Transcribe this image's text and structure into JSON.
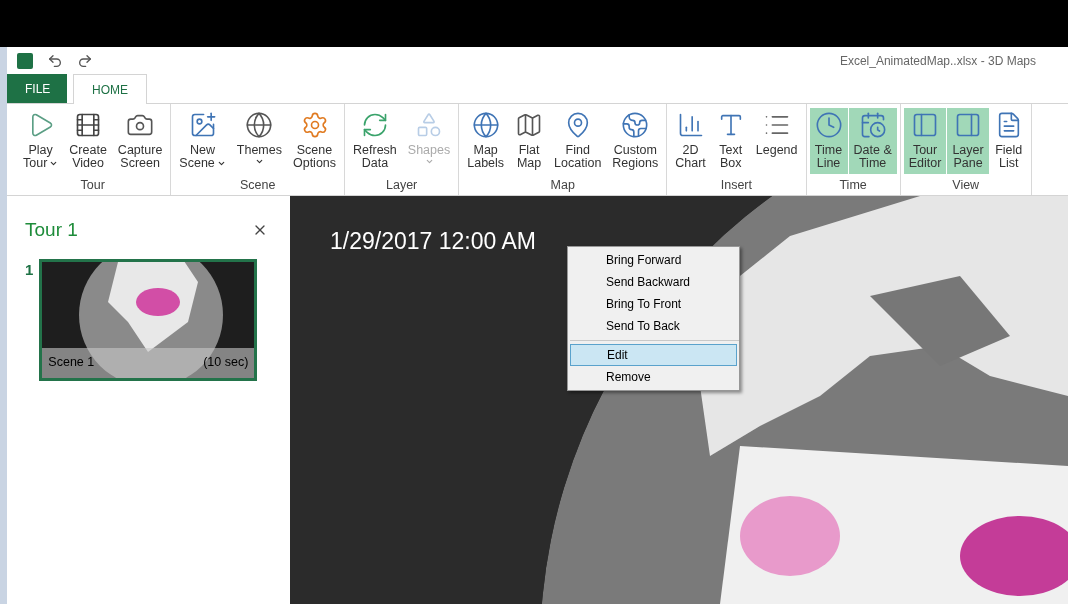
{
  "window": {
    "title": "Excel_AnimatedMap..xlsx - 3D Maps"
  },
  "tabs": [
    {
      "label": "FILE",
      "kind": "file"
    },
    {
      "label": "HOME",
      "kind": "tab",
      "selected": true
    }
  ],
  "ribbon": [
    {
      "label": "Tour",
      "buttons": [
        {
          "lines": [
            "Play",
            "Tour"
          ],
          "dropdown": true,
          "disabled": false,
          "selected": false
        },
        {
          "lines": [
            "Create",
            "Video"
          ],
          "dropdown": false,
          "disabled": false,
          "selected": false
        },
        {
          "lines": [
            "Capture",
            "Screen"
          ],
          "dropdown": false,
          "disabled": false,
          "selected": false
        }
      ]
    },
    {
      "label": "Scene",
      "buttons": [
        {
          "lines": [
            "New",
            "Scene"
          ],
          "dropdown": true,
          "disabled": false,
          "selected": false
        },
        {
          "lines": [
            "Themes"
          ],
          "dropdown": true,
          "disabled": false,
          "selected": false
        },
        {
          "lines": [
            "Scene",
            "Options"
          ],
          "dropdown": false,
          "disabled": false,
          "selected": false
        }
      ]
    },
    {
      "label": "Layer",
      "buttons": [
        {
          "lines": [
            "Refresh",
            "Data"
          ],
          "dropdown": false,
          "disabled": false,
          "selected": false
        },
        {
          "lines": [
            "Shapes"
          ],
          "dropdown": true,
          "disabled": true,
          "selected": false
        }
      ]
    },
    {
      "label": "Map",
      "buttons": [
        {
          "lines": [
            "Map",
            "Labels"
          ],
          "dropdown": false,
          "disabled": false,
          "selected": false
        },
        {
          "lines": [
            "Flat",
            "Map"
          ],
          "dropdown": false,
          "disabled": false,
          "selected": false
        },
        {
          "lines": [
            "Find",
            "Location"
          ],
          "dropdown": false,
          "disabled": false,
          "selected": false
        },
        {
          "lines": [
            "Custom",
            "Regions"
          ],
          "dropdown": false,
          "disabled": false,
          "selected": false
        }
      ]
    },
    {
      "label": "Insert",
      "buttons": [
        {
          "lines": [
            "2D",
            "Chart"
          ],
          "dropdown": false,
          "disabled": false,
          "selected": false
        },
        {
          "lines": [
            "Text",
            "Box"
          ],
          "dropdown": false,
          "disabled": false,
          "selected": false
        },
        {
          "lines": [
            "Legend"
          ],
          "dropdown": false,
          "disabled": false,
          "selected": false
        }
      ]
    },
    {
      "label": "Time",
      "buttons": [
        {
          "lines": [
            "Time",
            "Line"
          ],
          "dropdown": false,
          "disabled": false,
          "selected": true
        },
        {
          "lines": [
            "Date &",
            "Time"
          ],
          "dropdown": false,
          "disabled": false,
          "selected": true
        }
      ]
    },
    {
      "label": "View",
      "buttons": [
        {
          "lines": [
            "Tour",
            "Editor"
          ],
          "dropdown": false,
          "disabled": false,
          "selected": true
        },
        {
          "lines": [
            "Layer",
            "Pane"
          ],
          "dropdown": false,
          "disabled": false,
          "selected": true
        },
        {
          "lines": [
            "Field",
            "List"
          ],
          "dropdown": false,
          "disabled": false,
          "selected": false
        }
      ]
    }
  ],
  "tour_pane": {
    "title": "Tour 1",
    "scenes": [
      {
        "number": "1",
        "name": "Scene 1",
        "duration": "(10 sec)",
        "selected": true
      }
    ]
  },
  "map": {
    "timestamp": "1/29/2017 12:00 AM",
    "context_menu": [
      {
        "label": "Bring Forward",
        "selected": false
      },
      {
        "label": "Send Backward",
        "selected": false
      },
      {
        "label": "Bring To Front",
        "selected": false
      },
      {
        "label": "Send To Back",
        "selected": false
      },
      {
        "label": "Edit",
        "selected": true
      },
      {
        "label": "Remove",
        "selected": false
      }
    ]
  }
}
